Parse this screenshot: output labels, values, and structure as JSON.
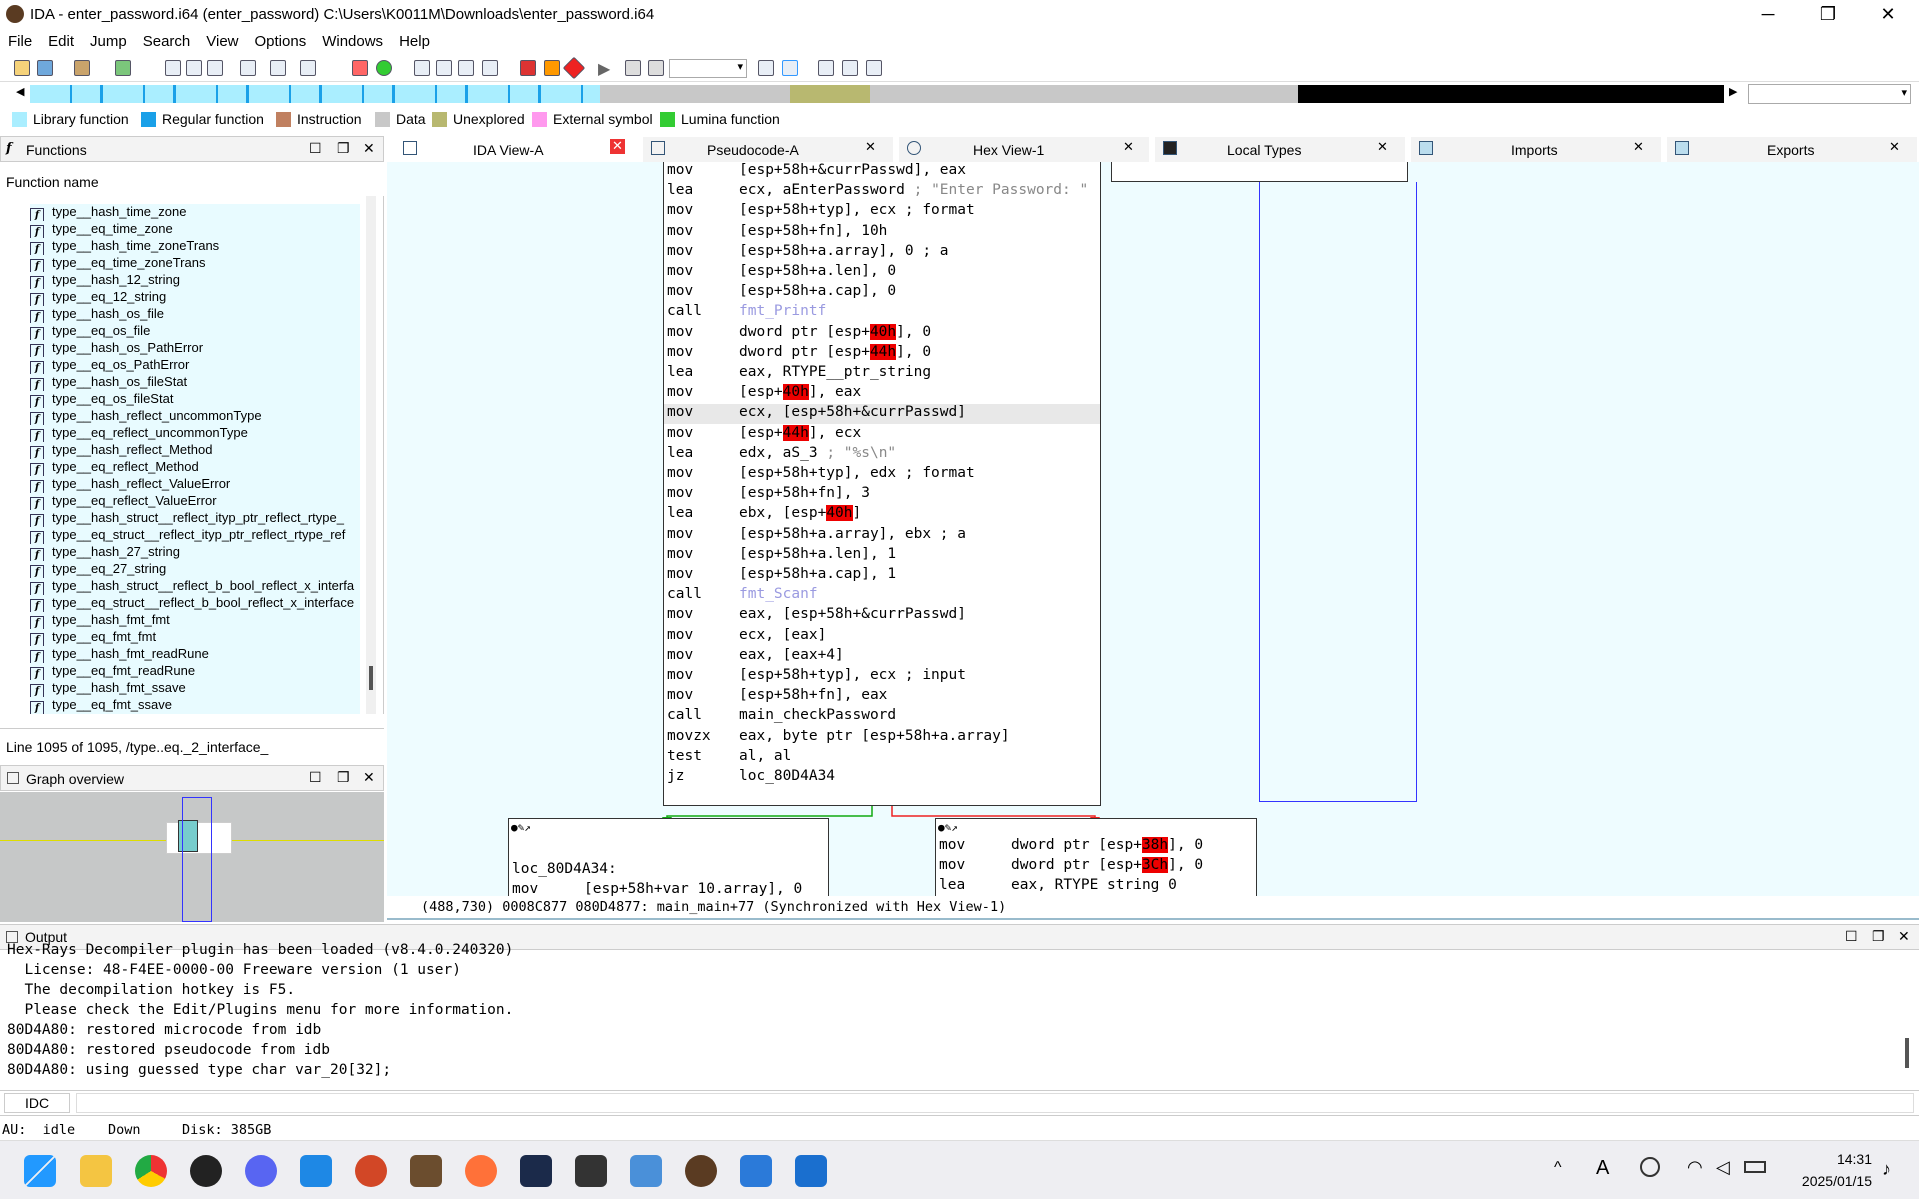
{
  "window": {
    "title": "IDA - enter_password.i64 (enter_password) C:\\Users\\K0011M\\Downloads\\enter_password.i64",
    "minimize": "─",
    "restore": "❐",
    "close": "✕"
  },
  "menu": [
    "File",
    "Edit",
    "Jump",
    "Search",
    "View",
    "Options",
    "Windows",
    "Help"
  ],
  "legend": [
    {
      "label": "Library function",
      "color": "#aaeeff"
    },
    {
      "label": "Regular function",
      "color": "#1aa0e8"
    },
    {
      "label": "Instruction",
      "color": "#c08060"
    },
    {
      "label": "Data",
      "color": "#c8c8c8"
    },
    {
      "label": "Unexplored",
      "color": "#b8b870"
    },
    {
      "label": "External symbol",
      "color": "#ff99ee"
    },
    {
      "label": "Lumina function",
      "color": "#33cc33"
    }
  ],
  "functions": {
    "title": "Functions",
    "header": "Function name",
    "status": "Line 1095 of 1095, /type..eq._2_interface_",
    "items": [
      "type__hash_time_zone",
      "type__eq_time_zone",
      "type__hash_time_zoneTrans",
      "type__eq_time_zoneTrans",
      "type__hash_12_string",
      "type__eq_12_string",
      "type__hash_os_file",
      "type__eq_os_file",
      "type__hash_os_PathError",
      "type__eq_os_PathError",
      "type__hash_os_fileStat",
      "type__eq_os_fileStat",
      "type__hash_reflect_uncommonType",
      "type__eq_reflect_uncommonType",
      "type__hash_reflect_Method",
      "type__eq_reflect_Method",
      "type__hash_reflect_ValueError",
      "type__eq_reflect_ValueError",
      "type__hash_struct__reflect_ityp_ptr_reflect_rtype_",
      "type__eq_struct__reflect_ityp_ptr_reflect_rtype_ref",
      "type__hash_27_string",
      "type__eq_27_string",
      "type__hash_struct__reflect_b_bool_reflect_x_interfa",
      "type__eq_struct__reflect_b_bool_reflect_x_interface",
      "type__hash_fmt_fmt",
      "type__eq_fmt_fmt",
      "type__hash_fmt_readRune",
      "type__eq_fmt_readRune",
      "type__hash_fmt_ssave",
      "type__eq_fmt_ssave"
    ]
  },
  "graph_overview": {
    "title": "Graph overview"
  },
  "tabs": [
    {
      "label": "IDA View-A"
    },
    {
      "label": "Pseudocode-A"
    },
    {
      "label": "Hex View-1"
    },
    {
      "label": "Local Types"
    },
    {
      "label": "Imports"
    },
    {
      "label": "Exports"
    }
  ],
  "asm_main": [
    [
      "mov",
      "[esp+58h+&currPasswd], eax"
    ],
    [
      "lea",
      "ecx, aEnterPassword ; \"Enter Password: \""
    ],
    [
      "mov",
      "[esp+58h+typ], ecx ; format"
    ],
    [
      "mov",
      "[esp+58h+fn], 10h"
    ],
    [
      "mov",
      "[esp+58h+a.array], 0 ; a"
    ],
    [
      "mov",
      "[esp+58h+a.len], 0"
    ],
    [
      "mov",
      "[esp+58h+a.cap], 0"
    ],
    [
      "call",
      "fmt_Printf"
    ],
    [
      "mov",
      "dword ptr [esp+40h], 0"
    ],
    [
      "mov",
      "dword ptr [esp+44h], 0"
    ],
    [
      "lea",
      "eax, RTYPE__ptr_string"
    ],
    [
      "mov",
      "[esp+40h], eax"
    ],
    [
      "mov",
      "ecx, [esp+58h+&currPasswd]"
    ],
    [
      "mov",
      "[esp+44h], ecx"
    ],
    [
      "lea",
      "edx, aS_3        ; \"%s\\n\""
    ],
    [
      "mov",
      "[esp+58h+typ], edx ; format"
    ],
    [
      "mov",
      "[esp+58h+fn], 3"
    ],
    [
      "lea",
      "ebx, [esp+40h]"
    ],
    [
      "mov",
      "[esp+58h+a.array], ebx ; a"
    ],
    [
      "mov",
      "[esp+58h+a.len], 1"
    ],
    [
      "mov",
      "[esp+58h+a.cap], 1"
    ],
    [
      "call",
      "fmt_Scanf"
    ],
    [
      "mov",
      "eax, [esp+58h+&currPasswd]"
    ],
    [
      "mov",
      "ecx, [eax]"
    ],
    [
      "mov",
      "eax, [eax+4]"
    ],
    [
      "mov",
      "[esp+58h+typ], ecx ; input"
    ],
    [
      "mov",
      "[esp+58h+fn], eax"
    ],
    [
      "call",
      "main_checkPassword"
    ],
    [
      "movzx",
      "eax, byte ptr [esp+58h+a.array]"
    ],
    [
      "test",
      "al, al"
    ],
    [
      "jz",
      "loc_80D4A34"
    ]
  ],
  "asm_left": {
    "label": "loc_80D4A34:",
    "line": [
      "mov",
      "[esp+58h+var_10.array], 0"
    ]
  },
  "asm_right": [
    [
      "mov",
      "dword ptr [esp+38h], 0"
    ],
    [
      "mov",
      "dword ptr [esp+3Ch], 0"
    ],
    [
      "lea",
      "eax, RTYPE string 0"
    ]
  ],
  "statusline": "(488,730) 0008C877 080D4877: main_main+77 (Synchronized with Hex View-1)",
  "output": {
    "title": "Output",
    "lines": [
      "Hex-Rays Decompiler plugin has been loaded (v8.4.0.240320)",
      "  License: 48-F4EE-0000-00 Freeware version (1 user)",
      "  The decompilation hotkey is F5.",
      "  Please check the Edit/Plugins menu for more information.",
      "80D4A80: restored microcode from idb",
      "80D4A80: restored pseudocode from idb",
      "80D4A80: using guessed type char var_20[32];"
    ]
  },
  "idc": "IDC",
  "bottom_status": {
    "au": "AU:  idle",
    "dir": "Down",
    "disk": "Disk: 385GB"
  },
  "taskbar": {
    "time": "14:31",
    "date": "2025/01/15",
    "ime": "A"
  }
}
